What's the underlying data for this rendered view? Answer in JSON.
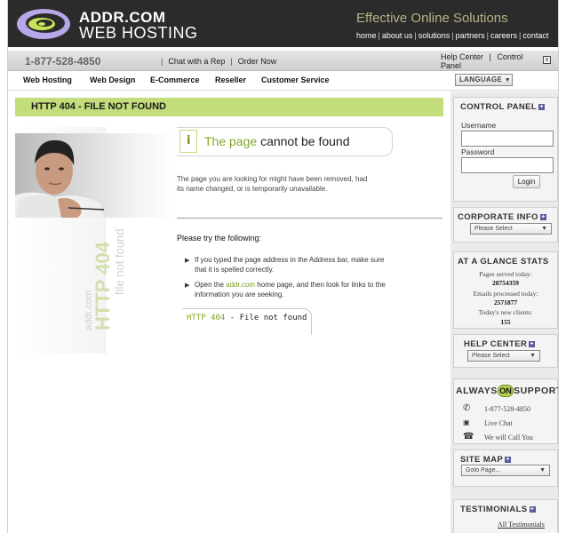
{
  "header": {
    "brand_line1": "ADDR.COM",
    "brand_line2": "WEB HOSTING",
    "tagline": "Effective Online Solutions",
    "links": [
      "home",
      "about us",
      "solutions",
      "partners",
      "careers",
      "contact"
    ]
  },
  "phonebar": {
    "phone": "1-877-528-4850",
    "chat": "Chat with a Rep",
    "order": "Order Now",
    "help_center": "Help Center",
    "control_panel": "Control Panel",
    "close_symbol": "x"
  },
  "nav": {
    "items": [
      "Web Hosting",
      "Web Design",
      "E-Commerce",
      "Reseller",
      "Customer Service"
    ],
    "language": "LANGUAGE"
  },
  "error": {
    "banner": "HTTP 404 - FILE NOT FOUND",
    "heading_green": "The page",
    "heading_dark": "cannot be found",
    "description": "The page you are looking for might have been removed, had its name changed, or is temporarily unavailable.",
    "try_label": "Please try the following:",
    "bullet1": "If you typed the page address in the Address bar, make sure that it is spelled correctly.",
    "bullet2_pre": "Open the",
    "bullet2_link": "addr.com",
    "bullet2_post": "home page, and then look for links to the information you are seeking.",
    "tab_green": "HTTP 404",
    "tab_dark": "- File not found",
    "vertical_small1": "addr.com",
    "vertical_big": "HTTP 404",
    "vertical_small2": "file not found",
    "info_icon": "i"
  },
  "sidebar": {
    "control_panel": {
      "title": "CONTROL PANEL",
      "username_label": "Username",
      "password_label": "Password",
      "login_button": "Login"
    },
    "corporate_info": {
      "title": "CORPORATE INFO",
      "select": "Please Select"
    },
    "stats": {
      "title": "AT A GLANCE STATS",
      "pages_label": "Pages served today:",
      "pages_value": "28754359",
      "emails_label": "Emails processed today:",
      "emails_value": "2571877",
      "clients_label": "Today's new clients:",
      "clients_value": "155"
    },
    "help_center": {
      "title": "HELP CENTER",
      "select": "Please Select"
    },
    "always_on": {
      "title_pre": "ALWAYS",
      "title_on": "ON",
      "title_post": "SUPPORT",
      "phone": "1-877-528-4850",
      "chat": "Live Chat",
      "call": "We will Call You"
    },
    "site_map": {
      "title": "SITE MAP",
      "select": "Goto Page..."
    },
    "testimonials": {
      "title": "TESTIMONIALS",
      "link": "All Testimonials"
    },
    "plus_symbol": "+",
    "arrow_symbol": "▼"
  },
  "colors": {
    "accent_green": "#c3dc7c",
    "link_green": "#84a82a",
    "header_bg": "#2b2b2b",
    "tagline_gold": "#b7b287"
  }
}
